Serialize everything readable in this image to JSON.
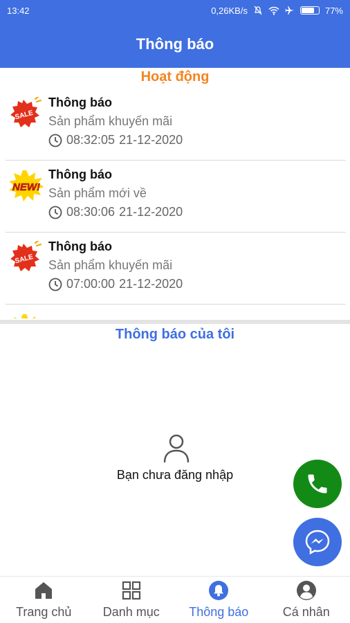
{
  "status_bar": {
    "time": "13:42",
    "network_speed": "0,26KB/s",
    "battery_percent": "77%",
    "icons": [
      "mute-icon",
      "wifi-icon",
      "airplane-icon",
      "battery-icon"
    ]
  },
  "app_bar": {
    "title": "Thông báo"
  },
  "activity_section": {
    "title": "Hoạt động",
    "items": [
      {
        "icon": "sale-badge-icon",
        "title": "Thông báo",
        "subtitle": "Sản phẩm khuyến mãi",
        "time": "08:32:05",
        "date": "21-12-2020"
      },
      {
        "icon": "new-badge-icon",
        "title": "Thông báo",
        "subtitle": "Sản phẩm mới về",
        "time": "08:30:06",
        "date": "21-12-2020"
      },
      {
        "icon": "sale-badge-icon",
        "title": "Thông báo",
        "subtitle": "Sản phẩm khuyến mãi",
        "time": "07:00:00",
        "date": "21-12-2020"
      }
    ]
  },
  "my_notifications": {
    "title": "Thông báo của tôi",
    "empty_text": "Bạn chưa đăng nhập"
  },
  "bottom_nav": {
    "items": [
      {
        "label": "Trang chủ",
        "icon": "home-icon",
        "active": false
      },
      {
        "label": "Danh mục",
        "icon": "grid-icon",
        "active": false
      },
      {
        "label": "Thông báo",
        "icon": "bell-icon",
        "active": true
      },
      {
        "label": "Cá nhân",
        "icon": "profile-icon",
        "active": false
      }
    ]
  },
  "colors": {
    "primary": "#3f6fe0",
    "activity_title": "#f5841f",
    "phone_fab": "#138a15"
  }
}
